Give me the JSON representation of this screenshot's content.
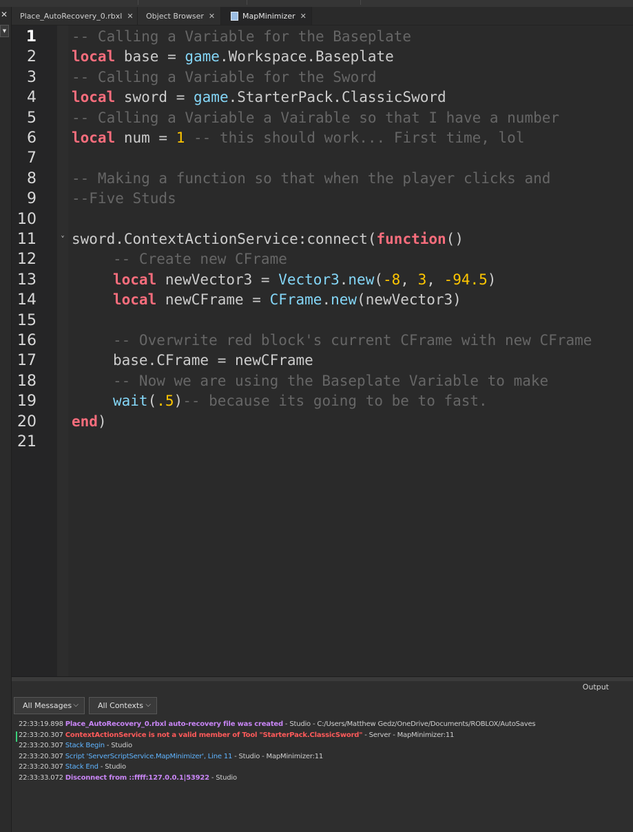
{
  "tabs": [
    {
      "label": "Place_AutoRecovery_0.rbxl",
      "close": "✕",
      "active": false
    },
    {
      "label": "Object Browser",
      "close": "✕",
      "active": false
    },
    {
      "label": "MapMinimizer",
      "close": "✕",
      "active": true
    }
  ],
  "left_panel": {
    "close": "✕",
    "dropdown": "▼"
  },
  "editor": {
    "current_line": 1,
    "lines": [
      {
        "n": "1",
        "tokens": [
          {
            "t": "-- Calling a Variable for the Baseplate",
            "c": "cm"
          }
        ],
        "indent": 0
      },
      {
        "n": "2",
        "tokens": [
          {
            "t": "local",
            "c": "kw"
          },
          {
            "t": " base = ",
            "c": "tx"
          },
          {
            "t": "game",
            "c": "gl"
          },
          {
            "t": ".Workspace.Baseplate",
            "c": "tx"
          }
        ],
        "indent": 0
      },
      {
        "n": "3",
        "tokens": [
          {
            "t": "-- Calling a Variable for the Sword",
            "c": "cm"
          }
        ],
        "indent": 0
      },
      {
        "n": "4",
        "tokens": [
          {
            "t": "local",
            "c": "kw"
          },
          {
            "t": " sword = ",
            "c": "tx"
          },
          {
            "t": "game",
            "c": "gl"
          },
          {
            "t": ".StarterPack.ClassicSword",
            "c": "tx"
          }
        ],
        "indent": 0
      },
      {
        "n": "5",
        "tokens": [
          {
            "t": "-- Calling a Variable a Vairable so that I have a number",
            "c": "cm"
          }
        ],
        "indent": 0
      },
      {
        "n": "6",
        "tokens": [
          {
            "t": "local",
            "c": "kw"
          },
          {
            "t": " num = ",
            "c": "tx"
          },
          {
            "t": "1",
            "c": "num"
          },
          {
            "t": " -- this should work... First time, lol",
            "c": "cm"
          }
        ],
        "indent": 0
      },
      {
        "n": "7",
        "tokens": [],
        "indent": 0
      },
      {
        "n": "8",
        "tokens": [
          {
            "t": "-- Making a function so that when the player clicks and",
            "c": "cm"
          }
        ],
        "indent": 0
      },
      {
        "n": "9",
        "tokens": [
          {
            "t": "--Five Studs",
            "c": "cm"
          }
        ],
        "indent": 0
      },
      {
        "n": "10",
        "tokens": [],
        "indent": 0
      },
      {
        "n": "11",
        "tokens": [
          {
            "t": "sword.ContextActionService:connect(",
            "c": "tx"
          },
          {
            "t": "function",
            "c": "kw"
          },
          {
            "t": "()",
            "c": "tx"
          }
        ],
        "indent": 0
      },
      {
        "n": "12",
        "tokens": [
          {
            "t": "-- Create new CFrame",
            "c": "cm"
          }
        ],
        "indent": 1
      },
      {
        "n": "13",
        "tokens": [
          {
            "t": "local",
            "c": "kw"
          },
          {
            "t": " newVector3 = ",
            "c": "tx"
          },
          {
            "t": "Vector3",
            "c": "gl"
          },
          {
            "t": ".",
            "c": "tx"
          },
          {
            "t": "new",
            "c": "gl"
          },
          {
            "t": "(",
            "c": "tx"
          },
          {
            "t": "-8",
            "c": "num"
          },
          {
            "t": ", ",
            "c": "tx"
          },
          {
            "t": "3",
            "c": "num"
          },
          {
            "t": ", ",
            "c": "tx"
          },
          {
            "t": "-94.5",
            "c": "num"
          },
          {
            "t": ")",
            "c": "tx"
          }
        ],
        "indent": 1
      },
      {
        "n": "14",
        "tokens": [
          {
            "t": "local",
            "c": "kw"
          },
          {
            "t": " newCFrame = ",
            "c": "tx"
          },
          {
            "t": "CFrame",
            "c": "gl"
          },
          {
            "t": ".",
            "c": "tx"
          },
          {
            "t": "new",
            "c": "gl"
          },
          {
            "t": "(newVector3)",
            "c": "tx"
          }
        ],
        "indent": 1
      },
      {
        "n": "15",
        "tokens": [],
        "indent": 1
      },
      {
        "n": "16",
        "tokens": [
          {
            "t": "-- Overwrite red block's current CFrame with new CFrame",
            "c": "cm"
          }
        ],
        "indent": 1
      },
      {
        "n": "17",
        "tokens": [
          {
            "t": "base.CFrame = newCFrame",
            "c": "tx"
          }
        ],
        "indent": 1
      },
      {
        "n": "18",
        "tokens": [
          {
            "t": "-- Now we are using the Baseplate Variable to make",
            "c": "cm"
          }
        ],
        "indent": 1
      },
      {
        "n": "19",
        "tokens": [
          {
            "t": "wait",
            "c": "gl"
          },
          {
            "t": "(",
            "c": "tx"
          },
          {
            "t": ".5",
            "c": "num"
          },
          {
            "t": ")",
            "c": "tx"
          },
          {
            "t": "-- because its going to be to fast.",
            "c": "cm"
          }
        ],
        "indent": 1
      },
      {
        "n": "20",
        "tokens": [
          {
            "t": "end",
            "c": "kw"
          },
          {
            "t": ")",
            "c": "tx"
          }
        ],
        "indent": 0
      },
      {
        "n": "21",
        "tokens": [],
        "indent": 0
      }
    ],
    "fold_arrow": "˅"
  },
  "output": {
    "title": "Output",
    "filters": [
      {
        "label": "All Messages",
        "chevron": "⌵"
      },
      {
        "label": "All Contexts",
        "chevron": "⌵"
      }
    ],
    "messages": [
      {
        "ts": "22:33:19.898",
        "main": "Place_AutoRecovery_0.rbxl auto-recovery file was created",
        "style": "purple",
        "rest": " - Studio - C:/Users/Matthew Gedz/OneDrive/Documents/ROBLOX/AutoSaves"
      },
      {
        "ts": "22:33:20.307",
        "main": "ContextActionService is not a valid member of Tool \"StarterPack.ClassicSword\"",
        "style": "red",
        "rest": " - Server - MapMinimizer:11"
      },
      {
        "ts": "22:33:20.307",
        "main": "Stack Begin",
        "style": "blue",
        "rest": " - Studio"
      },
      {
        "ts": "22:33:20.307",
        "main": "Script 'ServerScriptService.MapMinimizer', Line 11",
        "style": "blue",
        "rest": " - Studio - MapMinimizer:11"
      },
      {
        "ts": "22:33:20.307",
        "main": "Stack End",
        "style": "blue",
        "rest": " - Studio"
      },
      {
        "ts": "22:33:33.072",
        "main": "Disconnect from ::ffff:127.0.0.1|53922",
        "style": "purple",
        "rest": " - Studio"
      }
    ]
  },
  "colors": {
    "keyword": "#f86d7c",
    "comment": "#666666",
    "builtin": "#84d6f7",
    "number": "#ffc600",
    "text": "#cccccc",
    "error": "#ff5a5a",
    "info": "#c885f5",
    "stack": "#5fb4ff"
  }
}
